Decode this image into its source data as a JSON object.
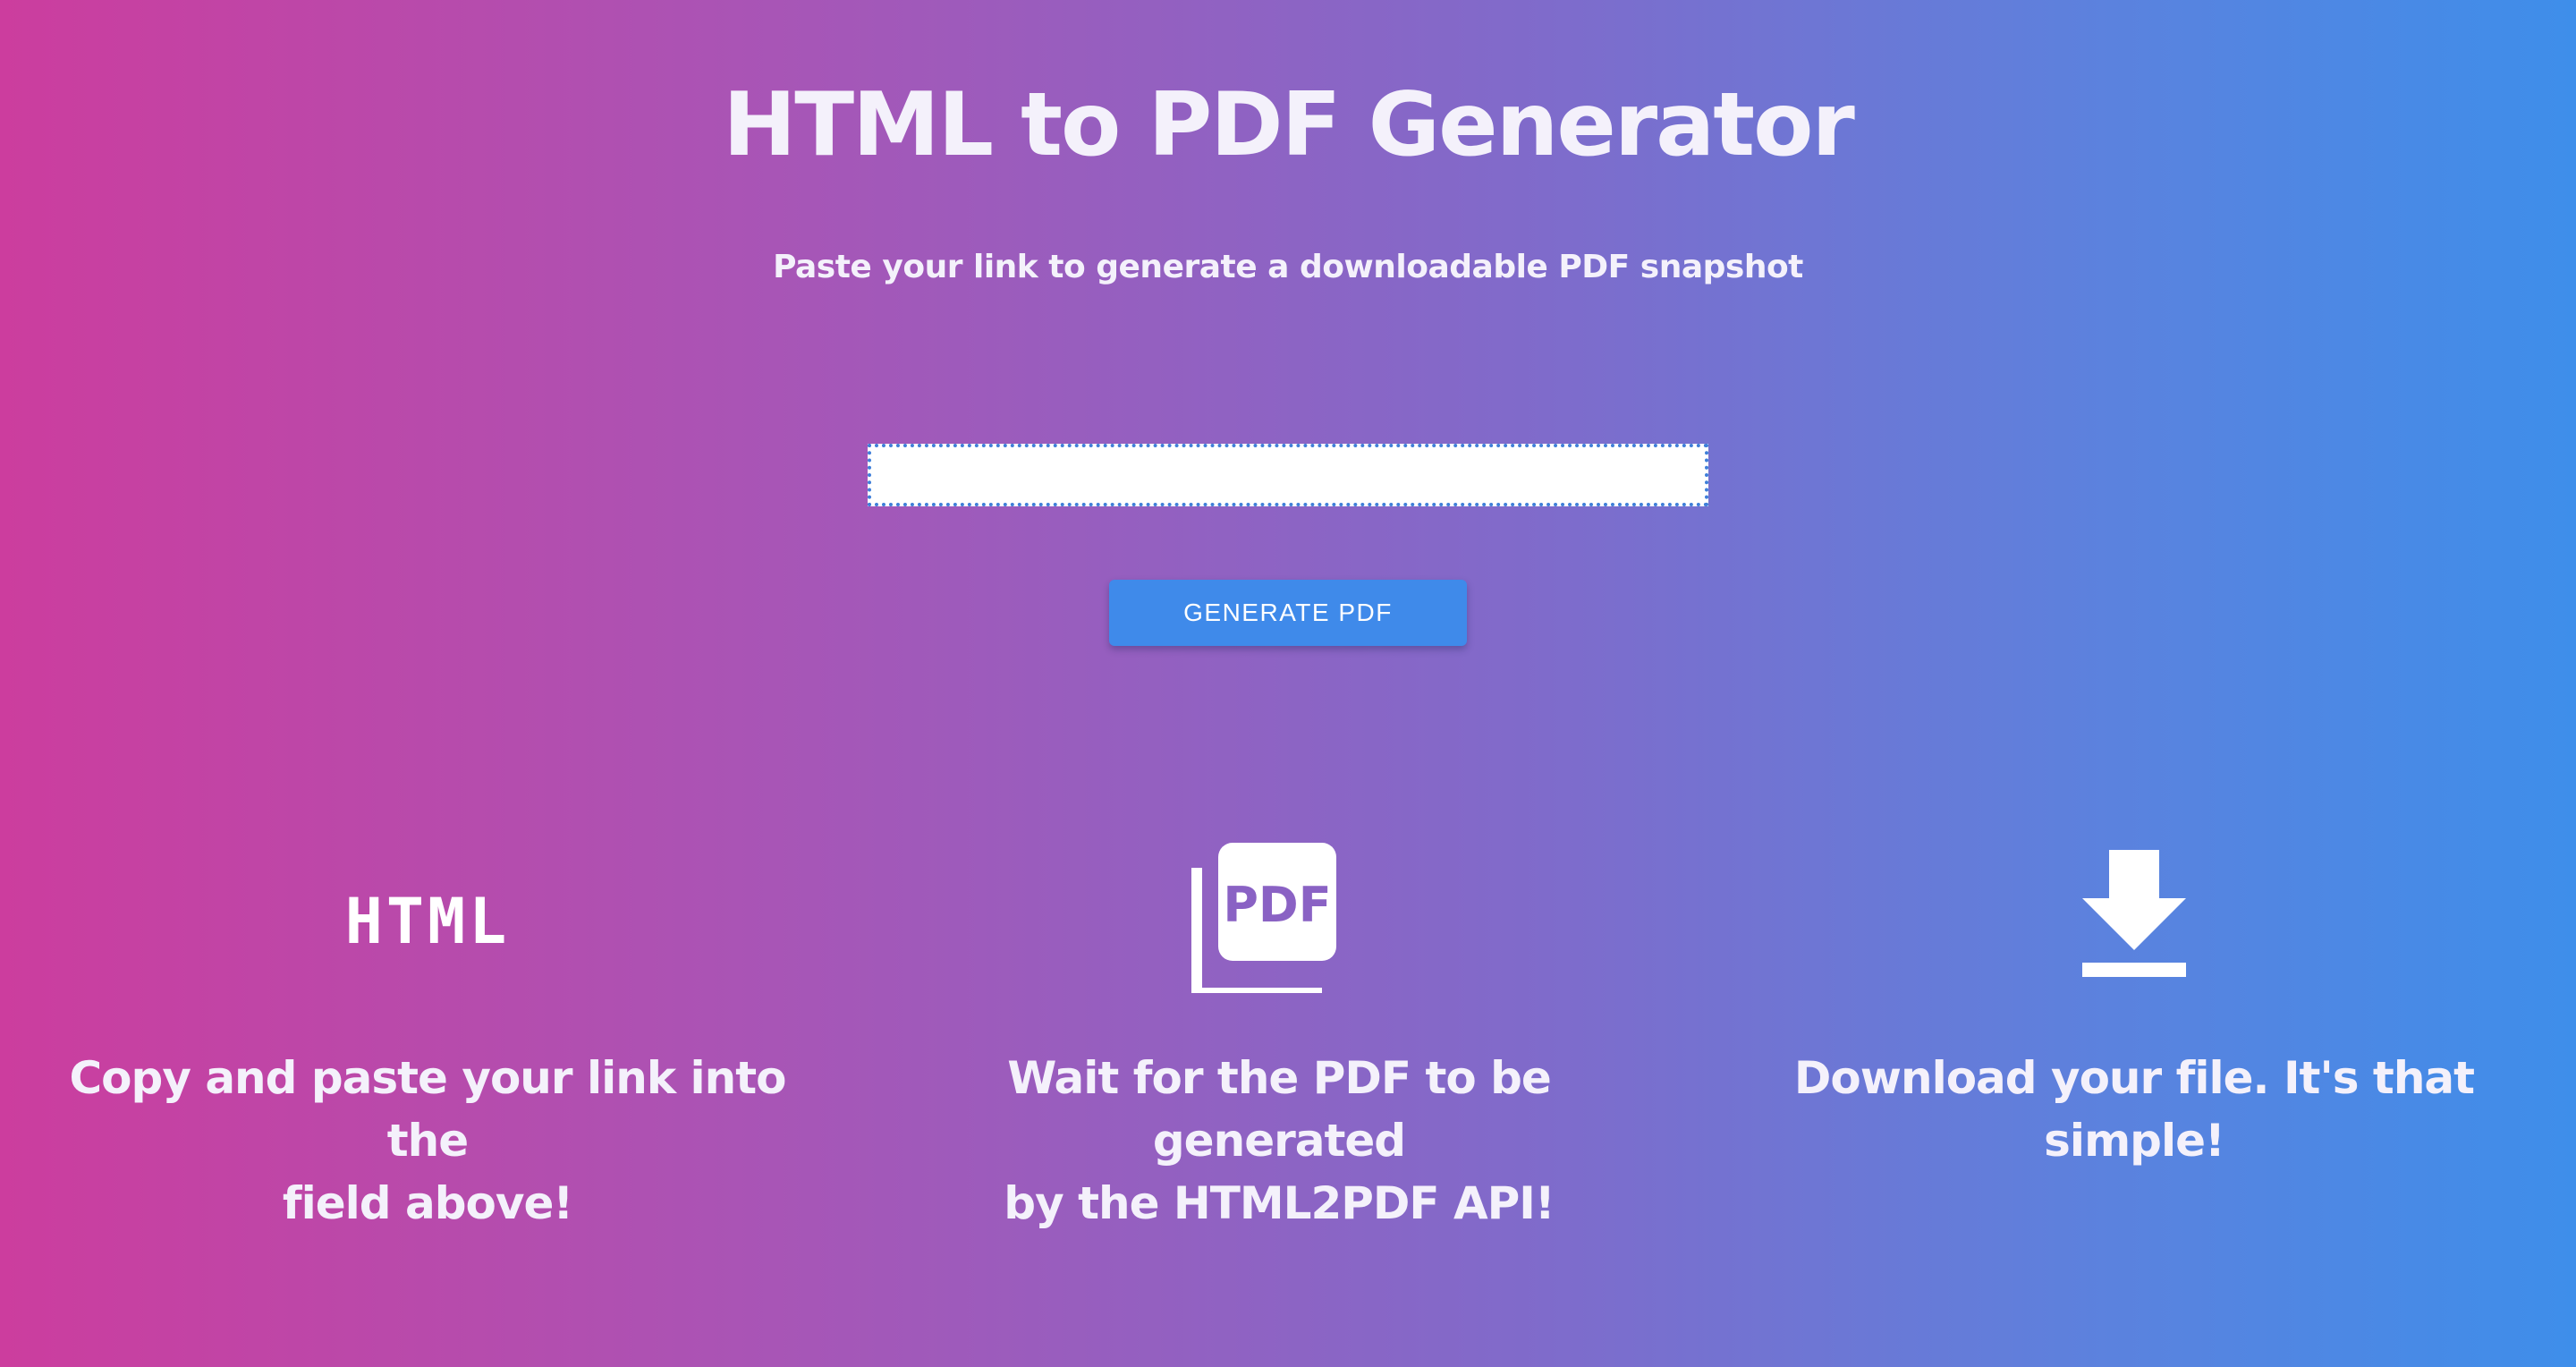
{
  "header": {
    "title": "HTML to PDF Generator",
    "subtitle": "Paste your link to generate a downloadable PDF snapshot"
  },
  "form": {
    "url_input_value": "",
    "url_input_placeholder": "",
    "generate_button_label": "GENERATE PDF"
  },
  "steps": [
    {
      "icon": "html-icon",
      "icon_text": "HTML",
      "caption_line1": "Copy and paste your link into the",
      "caption_line2": "field above!"
    },
    {
      "icon": "pdf-icon",
      "icon_text": "PDF",
      "caption_line1": "Wait for the PDF to be generated",
      "caption_line2": "by the HTML2PDF API!"
    },
    {
      "icon": "download-icon",
      "caption_line1": "Download your file. It's that",
      "caption_line2": "simple!"
    }
  ],
  "colors": {
    "gradient_start": "#cc3d9e",
    "gradient_end": "#3e8eea",
    "button": "#3f8aea",
    "input_border": "#3f7fd9"
  }
}
